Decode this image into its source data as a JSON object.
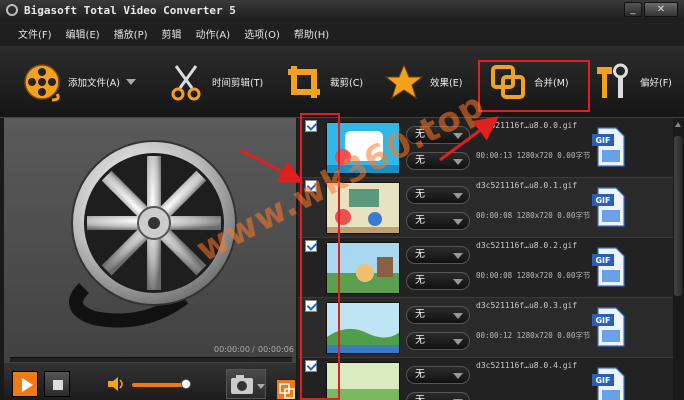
{
  "window": {
    "title": "Bigasoft Total Video Converter 5",
    "minimize": "_",
    "close": "✕"
  },
  "menu": [
    "文件(F)",
    "编辑(E)",
    "播放(P)",
    "剪辑",
    "动作(A)",
    "选项(O)",
    "帮助(H)"
  ],
  "toolbar": {
    "add_file": "添加文件(A)",
    "trim": "时间剪辑(T)",
    "crop": "裁剪(C)",
    "effect": "效果(E)",
    "merge": "合并(M)",
    "prefs": "偏好(F)"
  },
  "player": {
    "time_current": "00:00:00",
    "time_separator": "/",
    "time_total": "00:00:06",
    "volume_fraction": 0.9
  },
  "files": [
    {
      "name": "d3c521116f…u8.0.0.gif",
      "info": "00:00:13 1280x720  0.00字节",
      "audio": "无",
      "subtitle": "无",
      "checked": true
    },
    {
      "name": "d3c521116f…u8.0.1.gif",
      "info": "00:00:08 1280x720  0.00字节",
      "audio": "无",
      "subtitle": "无",
      "checked": true
    },
    {
      "name": "d3c521116f…u8.0.2.gif",
      "info": "00:00:08 1280x720  0.00字节",
      "audio": "无",
      "subtitle": "无",
      "checked": true
    },
    {
      "name": "d3c521116f…u8.0.3.gif",
      "info": "00:00:12 1280x720  0.00字节",
      "audio": "无",
      "subtitle": "无",
      "checked": true
    },
    {
      "name": "d3c521116f…u8.0.4.gif",
      "info": "",
      "audio": "无",
      "subtitle": "无",
      "checked": true
    }
  ],
  "output_badge": "GIF",
  "watermark": "www.wk360.top",
  "colors": {
    "accent": "#f07a18",
    "highlight": "#e02020",
    "check": "#1a6ad0"
  }
}
